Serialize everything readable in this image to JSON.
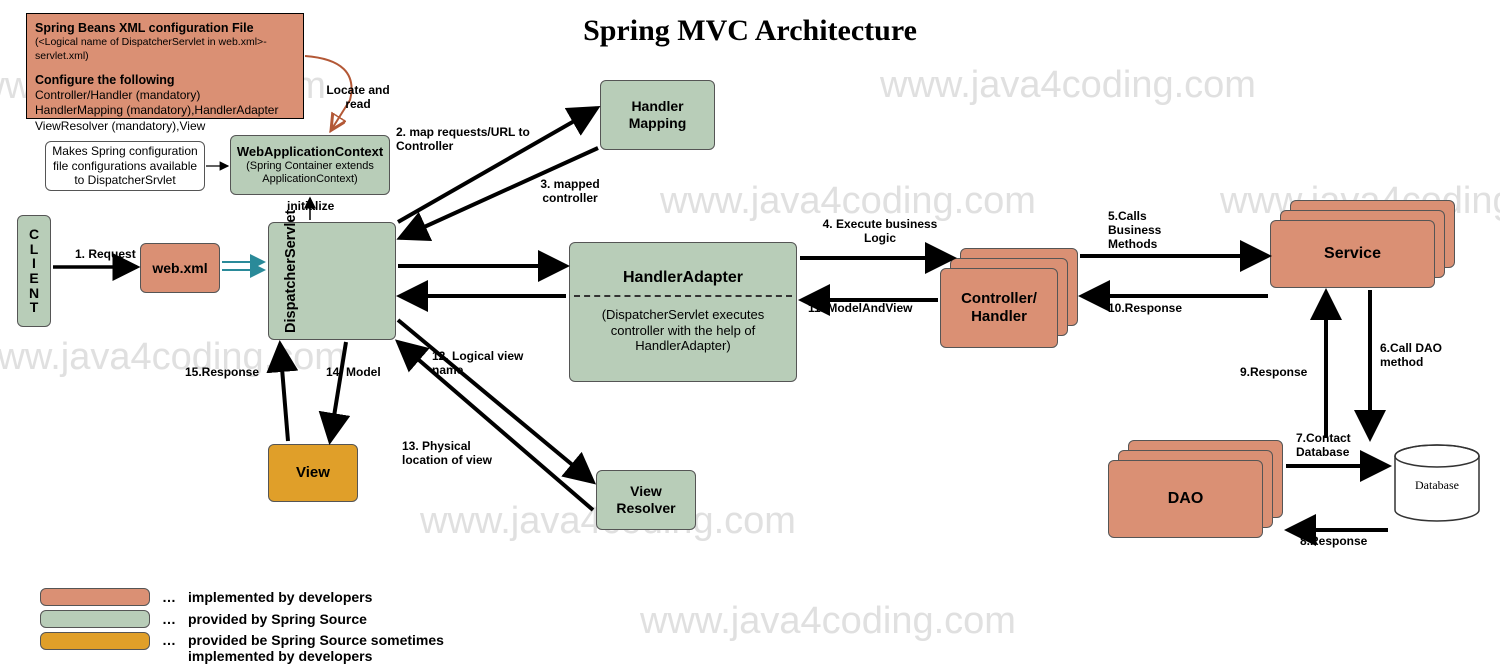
{
  "title": "Spring MVC Architecture",
  "watermark": "www.java4coding.com",
  "config": {
    "hdr1": "Spring Beans XML configuration File",
    "sub1": "(<Logical name of DispatcherServlet in web.xml>-servlet.xml)",
    "hdr2": "Configure the following",
    "line1": "Controller/Handler (mandatory)",
    "line2": "HandlerMapping (mandatory),HandlerAdapter",
    "line3": "ViewResolver (mandatory),View"
  },
  "wac_note": "Makes Spring configuration file configurations available to DispatcherSrvlet",
  "nodes": {
    "client": "C\nL\nI\nE\nN\nT",
    "webxml": "web.xml",
    "wac": "WebApplicationContext",
    "wac_sub": "(Spring Container extends ApplicationContext)",
    "dispatcher": "DispatcherServlet",
    "handler_mapping": "Handler Mapping",
    "handler_adapter": "HandlerAdapter",
    "handler_adapter_sub": "(DispatcherServlet executes controller with the help of HandlerAdapter)",
    "controller": "Controller/ Handler",
    "service": "Service",
    "dao": "DAO",
    "database": "Database",
    "view": "View",
    "view_resolver": "View Resolver"
  },
  "labels": {
    "locate_read": "Locate and read",
    "initialize": "initialize",
    "l1": "1. Request",
    "l2": "2. map requests/URL to Controller",
    "l3": "3. mapped controller",
    "l4": "4. Execute business Logic",
    "l5": "5.Calls Business Methods",
    "l6": "6.Call DAO method",
    "l7": "7.Contact Database",
    "l8": "8.Response",
    "l9": "9.Response",
    "l10": "10.Response",
    "l11": "11. ModelAndView",
    "l12": "12. Logical view name",
    "l13": "13. Physical location of view",
    "l14": "14. Model",
    "l15": "15.Response"
  },
  "legend": {
    "dev": "implemented by developers",
    "spring": "provided by Spring Source",
    "both": "provided be Spring Source sometimes implemented by developers",
    "dots": "…"
  }
}
